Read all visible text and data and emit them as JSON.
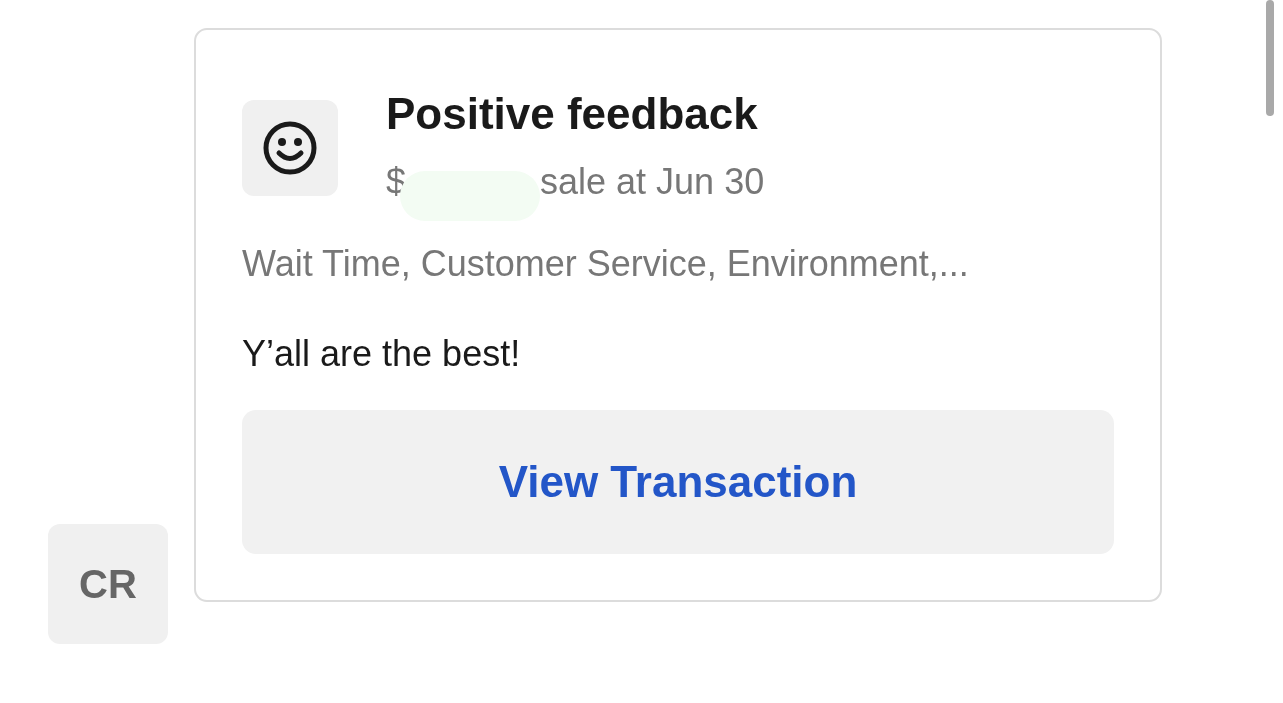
{
  "avatar": {
    "initials": "CR"
  },
  "card": {
    "title": "Positive feedback",
    "amount_prefix": "$",
    "amount_redacted": true,
    "sale_text": "sale at Jun 30",
    "tags": "Wait Time, Customer Service, Environment,...",
    "comment": "Y’all are the best!",
    "button": "View Transaction"
  }
}
